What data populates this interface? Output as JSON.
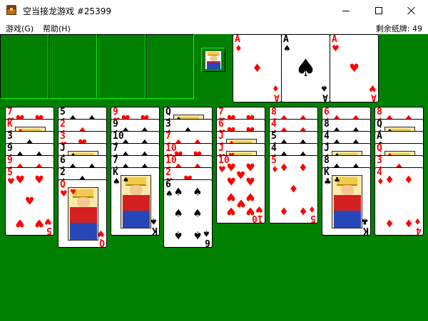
{
  "window": {
    "title": "空当接龙游戏 #25399"
  },
  "menu": {
    "game": "游戏(G)",
    "help": "帮助(H)"
  },
  "status": {
    "remaining_text": "剩余纸牌: 49"
  },
  "colors": {
    "felt": "#008000",
    "red_suit": "#ff0000",
    "black_suit": "#000000"
  },
  "foundations": [
    {
      "rank": "A",
      "suit": "♦",
      "color": "red"
    },
    {
      "rank": "A",
      "suit": "♠",
      "color": "black"
    },
    {
      "rank": "A",
      "suit": "♥",
      "color": "red"
    }
  ],
  "tableau": [
    [
      {
        "rank": "7",
        "suit": "♥",
        "color": "red"
      },
      {
        "rank": "K",
        "suit": "♦",
        "color": "red"
      },
      {
        "rank": "3",
        "suit": "♠",
        "color": "black"
      },
      {
        "rank": "9",
        "suit": "♠",
        "color": "black"
      },
      {
        "rank": "9",
        "suit": "♦",
        "color": "red"
      },
      {
        "rank": "5",
        "suit": "♥",
        "color": "red"
      }
    ],
    [
      {
        "rank": "5",
        "suit": "♠",
        "color": "black"
      },
      {
        "rank": "2",
        "suit": "♦",
        "color": "red"
      },
      {
        "rank": "3",
        "suit": "♥",
        "color": "red"
      },
      {
        "rank": "J",
        "suit": "♠",
        "color": "black"
      },
      {
        "rank": "6",
        "suit": "♠",
        "color": "black"
      },
      {
        "rank": "2",
        "suit": "♠",
        "color": "black"
      },
      {
        "rank": "Q",
        "suit": "♥",
        "color": "red"
      }
    ],
    [
      {
        "rank": "9",
        "suit": "♥",
        "color": "red"
      },
      {
        "rank": "9",
        "suit": "♠",
        "color": "black"
      },
      {
        "rank": "10",
        "suit": "♠",
        "color": "black"
      },
      {
        "rank": "7",
        "suit": "♠",
        "color": "black"
      },
      {
        "rank": "7",
        "suit": "♠",
        "color": "black"
      },
      {
        "rank": "K",
        "suit": "♠",
        "color": "black"
      }
    ],
    [
      {
        "rank": "Q",
        "suit": "♠",
        "color": "black"
      },
      {
        "rank": "3",
        "suit": "♠",
        "color": "black"
      },
      {
        "rank": "7",
        "suit": "♦",
        "color": "red"
      },
      {
        "rank": "10",
        "suit": "♥",
        "color": "red"
      },
      {
        "rank": "10",
        "suit": "♦",
        "color": "red"
      },
      {
        "rank": "2",
        "suit": "♥",
        "color": "red"
      },
      {
        "rank": "6",
        "suit": "♠",
        "color": "black"
      }
    ],
    [
      {
        "rank": "7",
        "suit": "♥",
        "color": "red"
      },
      {
        "rank": "6",
        "suit": "♥",
        "color": "red"
      },
      {
        "rank": "J",
        "suit": "♦",
        "color": "red"
      },
      {
        "rank": "J",
        "suit": "♥",
        "color": "red"
      },
      {
        "rank": "10",
        "suit": "♥",
        "color": "red"
      }
    ],
    [
      {
        "rank": "8",
        "suit": "♦",
        "color": "red"
      },
      {
        "rank": "4",
        "suit": "♦",
        "color": "red"
      },
      {
        "rank": "5",
        "suit": "♠",
        "color": "black"
      },
      {
        "rank": "4",
        "suit": "♠",
        "color": "black"
      },
      {
        "rank": "5",
        "suit": "♦",
        "color": "red"
      }
    ],
    [
      {
        "rank": "6",
        "suit": "♦",
        "color": "red"
      },
      {
        "rank": "8",
        "suit": "♠",
        "color": "black"
      },
      {
        "rank": "4",
        "suit": "♠",
        "color": "black"
      },
      {
        "rank": "J",
        "suit": "♠",
        "color": "black"
      },
      {
        "rank": "8",
        "suit": "♠",
        "color": "black"
      },
      {
        "rank": "K",
        "suit": "♣",
        "color": "black"
      }
    ],
    [
      {
        "rank": "8",
        "suit": "♦",
        "color": "red"
      },
      {
        "rank": "Q",
        "suit": "♠",
        "color": "black"
      },
      {
        "rank": "A",
        "suit": "♣",
        "color": "black"
      },
      {
        "rank": "Q",
        "suit": "♦",
        "color": "red"
      },
      {
        "rank": "3",
        "suit": "♦",
        "color": "red"
      },
      {
        "rank": "4",
        "suit": "♦",
        "color": "red"
      }
    ]
  ]
}
